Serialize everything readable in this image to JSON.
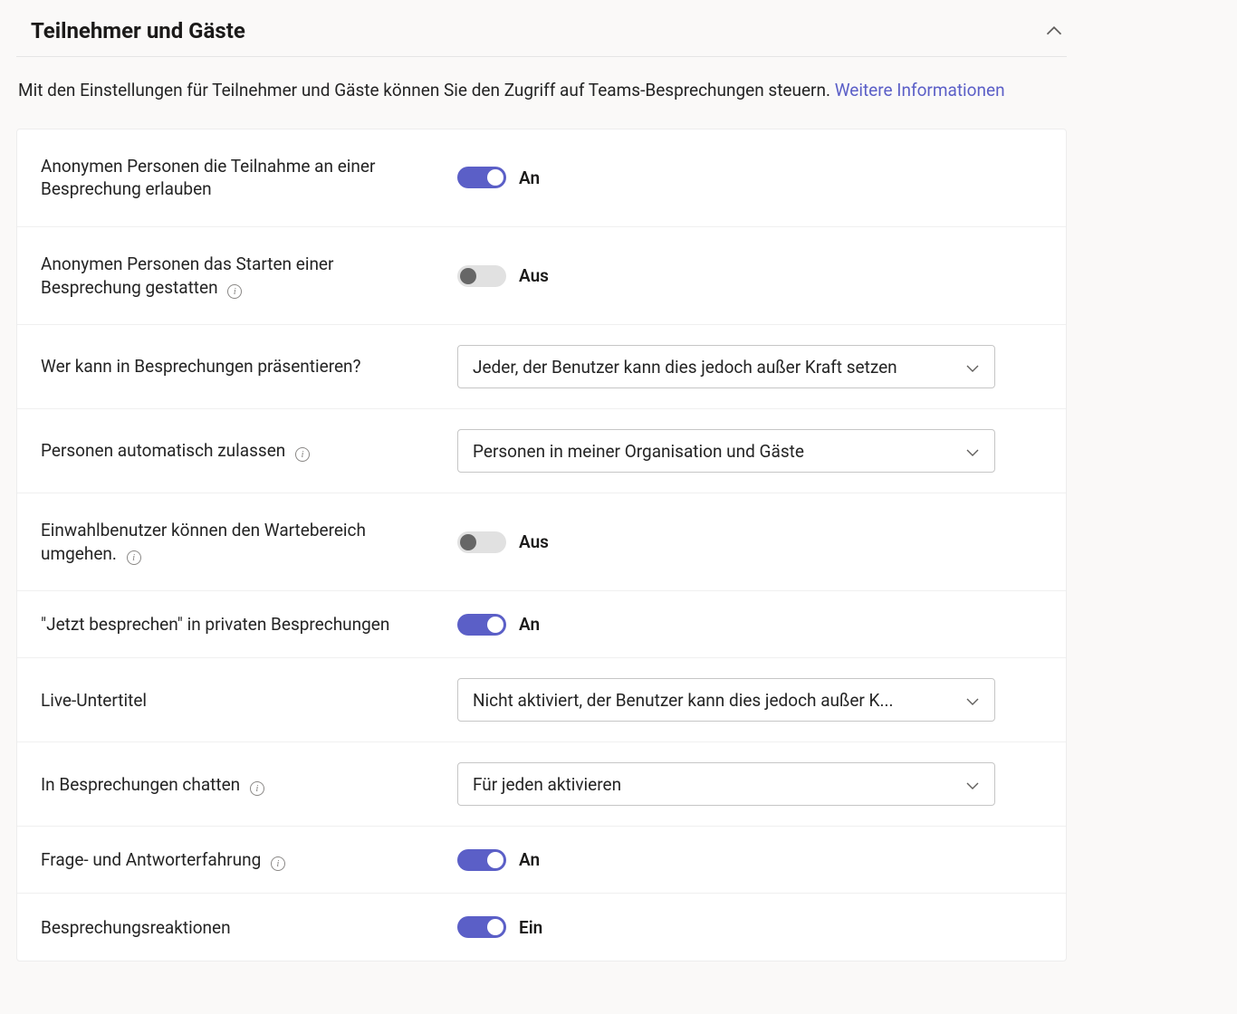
{
  "header": {
    "title": "Teilnehmer und Gäste"
  },
  "description": {
    "text": "Mit den Einstellungen für Teilnehmer und Gäste können Sie den Zugriff auf Teams-Besprechungen steuern. ",
    "link_text": "Weitere Informationen"
  },
  "state_labels": {
    "on": "An",
    "off": "Aus",
    "ein": "Ein"
  },
  "rows": [
    {
      "label": "Anonymen Personen die Teilnahme an einer Besprechung erlauben",
      "type": "toggle",
      "on": true,
      "state_key": "on",
      "info": false
    },
    {
      "label": "Anonymen Personen das Starten einer Besprechung gestatten",
      "type": "toggle",
      "on": false,
      "state_key": "off",
      "info": true
    },
    {
      "label": "Wer kann in Besprechungen präsentieren?",
      "type": "dropdown",
      "value": "Jeder, der Benutzer kann dies jedoch außer Kraft setzen",
      "info": false
    },
    {
      "label": "Personen automatisch zulassen",
      "type": "dropdown",
      "value": "Personen in meiner Organisation und Gäste",
      "info": true
    },
    {
      "label": "Einwahlbenutzer können den Wartebereich umgehen.",
      "type": "toggle",
      "on": false,
      "state_key": "off",
      "info": true
    },
    {
      "label": "\"Jetzt besprechen\" in privaten Besprechungen",
      "type": "toggle",
      "on": true,
      "state_key": "on",
      "info": false
    },
    {
      "label": "Live-Untertitel",
      "type": "dropdown",
      "value": "Nicht aktiviert, der Benutzer kann dies jedoch außer K...",
      "info": false
    },
    {
      "label": "In Besprechungen chatten",
      "type": "dropdown",
      "value": "Für jeden aktivieren",
      "info": true
    },
    {
      "label": "Frage- und Antworterfahrung",
      "type": "toggle",
      "on": true,
      "state_key": "on",
      "info": true
    },
    {
      "label": "Besprechungsreaktionen",
      "type": "toggle",
      "on": true,
      "state_key": "ein",
      "info": false
    }
  ]
}
